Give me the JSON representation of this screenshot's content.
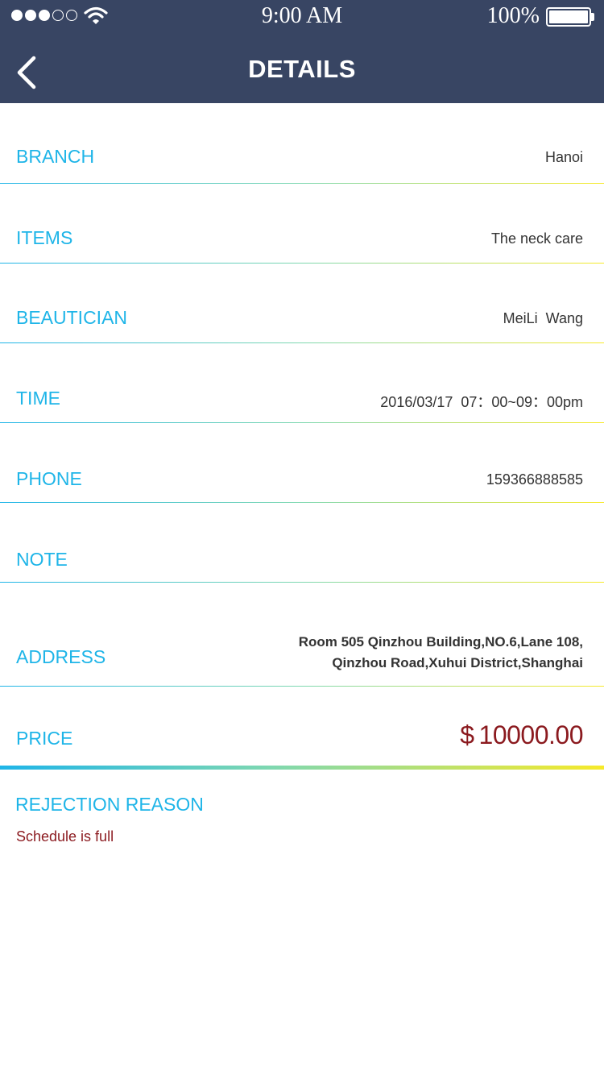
{
  "status_bar": {
    "time": "9:00 AM",
    "battery_percent": "100%",
    "signal_full_dots": 3,
    "signal_total_dots": 5
  },
  "nav": {
    "title": "DETAILS",
    "back_icon": "chevron-left-icon"
  },
  "details": {
    "branch": {
      "label": "BRANCH",
      "value": "Hanoi"
    },
    "items": {
      "label": "ITEMS",
      "value": "The neck care"
    },
    "beautician": {
      "label": "BEAUTICIAN",
      "value": "MeiLi  Wang"
    },
    "time": {
      "label": "TIME",
      "value": "2016/03/17  07：00~09：00pm"
    },
    "phone": {
      "label": "PHONE",
      "value": "159366888585"
    },
    "note": {
      "label": "NOTE",
      "value": ""
    },
    "address": {
      "label": "ADDRESS",
      "line1": "Room 505 Qinzhou Building,NO.6,Lane 108,",
      "line2": "Qinzhou Road,Xuhui District,Shanghai"
    },
    "price": {
      "label": "PRICE",
      "symbol": "$",
      "amount": "10000.00"
    }
  },
  "rejection": {
    "title": "REJECTION REASON",
    "reason": "Schedule is full"
  },
  "colors": {
    "header_bg": "#384563",
    "label": "#1fb5e8",
    "price": "#8b1a1f",
    "gradient_start": "#1fb5e8",
    "gradient_end": "#f7ea2a"
  }
}
